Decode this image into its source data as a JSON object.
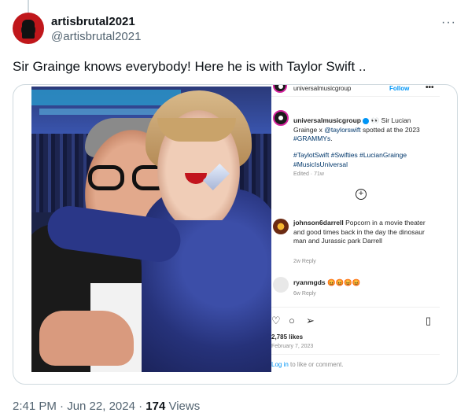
{
  "tweet": {
    "display_name": "artisbrutal2021",
    "handle": "@artisbrutal2021",
    "more_label": "···",
    "text": "Sir Grainge knows everybody! Here he is with Taylor Swift ..",
    "timestamp": "2:41 PM · Jun 22, 2024 · ",
    "views_count": "174",
    "views_label": " Views"
  },
  "instagram": {
    "header_account": "universalmusicgroup",
    "follow_label": "Follow",
    "more_label": "•••",
    "caption_account": "universalmusicgroup",
    "caption_text": " Sir Lucian Grainge x ",
    "caption_mention": "@taylorswift",
    "caption_text2": " spotted at the 2023 ",
    "caption_tag": "#GRAMMYs",
    "caption_end": ".",
    "hashtags": "#TaylotSwift #Swifties #LucianGrainge #MusicIsUniversal",
    "edited": "Edited · 71w",
    "comments": [
      {
        "user": "johnson6darrell",
        "text": " Popcorn in a movie theater and good times back in the day the dinosaur man and Jurassic park Darrell",
        "meta": "2w   Reply"
      },
      {
        "user": "ryanmgds",
        "text": " 😡😡😡😡",
        "meta": "6w   Reply"
      }
    ],
    "likes": "2,785 likes",
    "post_date": "February 7, 2023",
    "login_link": "Log in",
    "login_rest": " to like or comment."
  },
  "colors": {
    "text_primary": "#0f1419",
    "text_secondary": "#536471",
    "border": "#cfd9de",
    "ig_blue": "#0095f6",
    "ig_link": "#00376b"
  }
}
